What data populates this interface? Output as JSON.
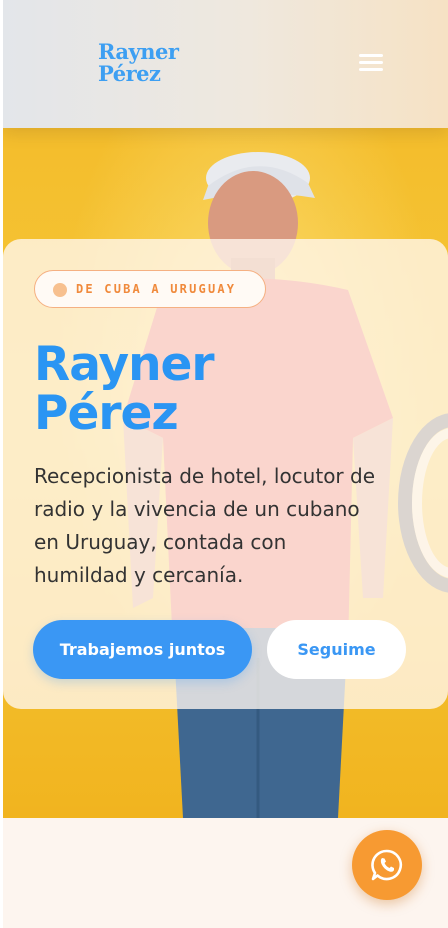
{
  "header": {
    "brand_line1": "Rayner",
    "brand_line2": "Pérez",
    "menu_icon": "hamburger-menu-icon"
  },
  "hero": {
    "tag": "DE CUBA A URUGUAY",
    "title_line1": "Rayner",
    "title_line2": "Pérez",
    "description": "Recepcionista de hotel, locutor de radio y la vivencia de un cubano en Uruguay, contada con humildad y cercanía.",
    "primary_button": "Trabajemos juntos",
    "secondary_button": "Seguime"
  },
  "floating": {
    "whatsapp_icon": "whatsapp-icon"
  },
  "colors": {
    "accent": "#3a97f4",
    "brand": "#2a95f3",
    "orange": "#f79a32",
    "hero_bg": "#f4bd2c"
  }
}
